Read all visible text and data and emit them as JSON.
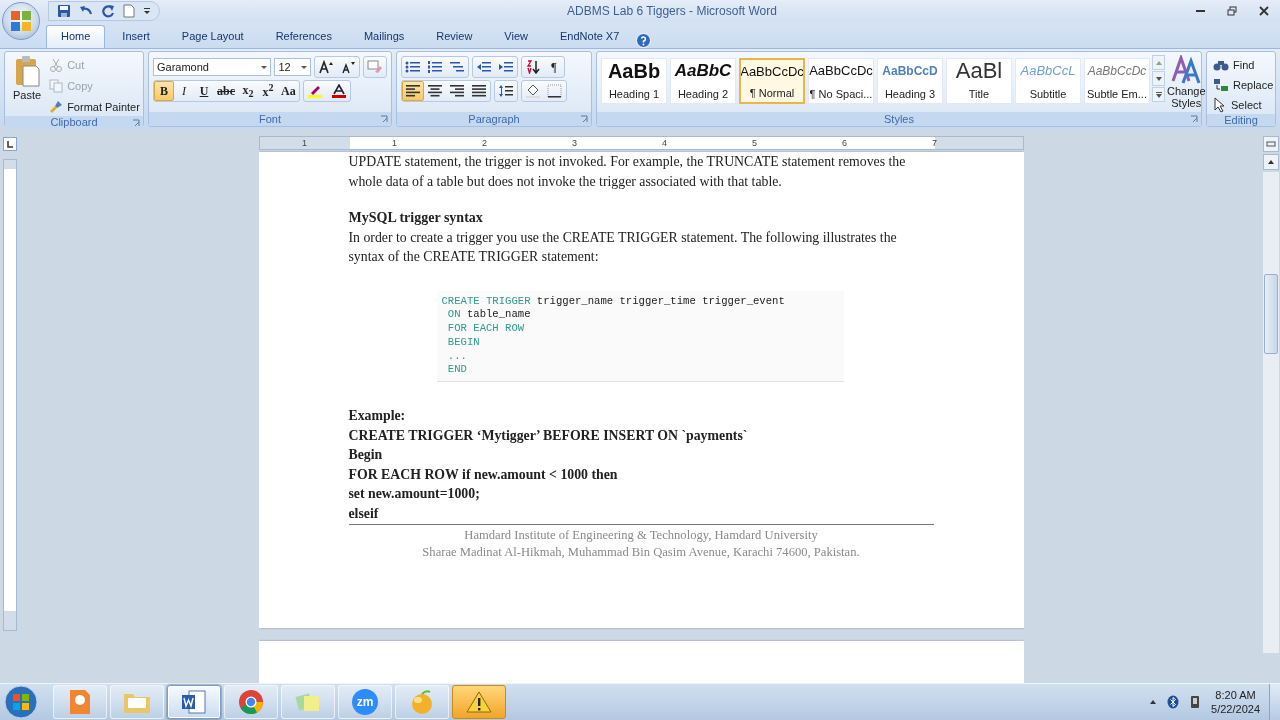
{
  "window": {
    "title": "ADBMS Lab 6 Tiggers - Microsoft Word"
  },
  "quick_access": [
    {
      "kind": "save"
    },
    {
      "kind": "undo"
    },
    {
      "kind": "redo"
    },
    {
      "kind": "new"
    },
    {
      "kind": "more"
    }
  ],
  "tabs": [
    {
      "label": "Home",
      "selected": true
    },
    {
      "label": "Insert",
      "selected": false
    },
    {
      "label": "Page Layout",
      "selected": false
    },
    {
      "label": "References",
      "selected": false
    },
    {
      "label": "Mailings",
      "selected": false
    },
    {
      "label": "Review",
      "selected": false
    },
    {
      "label": "View",
      "selected": false
    },
    {
      "label": "EndNote X7",
      "selected": false
    }
  ],
  "clipboard": {
    "title": "Clipboard",
    "paste": "Paste",
    "items": [
      {
        "label": "Cut",
        "kind": "cut",
        "disabled": true
      },
      {
        "label": "Copy",
        "kind": "copy",
        "disabled": true
      },
      {
        "label": "Format Painter",
        "kind": "brush",
        "disabled": false
      }
    ]
  },
  "font": {
    "title": "Font",
    "name": "Garamond",
    "size": "12",
    "tools": [
      {
        "kind": "grow"
      },
      {
        "kind": "shrink"
      },
      {
        "kind": "clear"
      }
    ],
    "buttons": [
      {
        "kind": "bold",
        "label": "B",
        "selected": true
      },
      {
        "kind": "italic",
        "label": "I",
        "selected": false
      },
      {
        "kind": "underline",
        "label": "U",
        "selected": false
      },
      {
        "kind": "strike",
        "label": "abc",
        "selected": false
      },
      {
        "kind": "subscript",
        "label": "x$_{2}$",
        "selected": false
      },
      {
        "kind": "superscript",
        "label": "x$^{2}$",
        "selected": false
      },
      {
        "kind": "case",
        "label": "Aa",
        "selected": false
      },
      {
        "kind": "highlight",
        "selected": false
      },
      {
        "kind": "fontcolor",
        "selected": false
      }
    ]
  },
  "paragraph": {
    "title": "Paragraph",
    "row1": [
      {
        "kind": "bullets",
        "selected": false
      },
      {
        "kind": "numbering",
        "selected": false
      },
      {
        "kind": "multilevel",
        "selected": false
      },
      {
        "kind": "outdent",
        "selected": false
      },
      {
        "kind": "indent",
        "selected": false
      },
      {
        "kind": "sort",
        "selected": false
      },
      {
        "kind": "text",
        "label": "¶",
        "selected": false
      }
    ],
    "row2": [
      {
        "kind": "align-left",
        "selected": true
      },
      {
        "kind": "align-center",
        "selected": false
      },
      {
        "kind": "align-right",
        "selected": false
      },
      {
        "kind": "justify",
        "selected": false
      },
      {
        "kind": "spacing",
        "selected": false
      },
      {
        "kind": "shading",
        "selected": false
      },
      {
        "kind": "borders",
        "selected": false
      }
    ]
  },
  "styles": {
    "title": "Styles",
    "items": [
      {
        "preview": "AaBb",
        "label": "Heading 1",
        "kind": "h1",
        "selected": false
      },
      {
        "preview": "AaBbC",
        "label": "Heading 2",
        "kind": "h2",
        "selected": false
      },
      {
        "preview": "AaBbCcDc",
        "label": "¶ Normal",
        "kind": "normal",
        "selected": true
      },
      {
        "preview": "AaBbCcDc",
        "label": "¶ No Spaci...",
        "kind": "normal",
        "selected": false
      },
      {
        "preview": "AaBbCcD",
        "label": "Heading 3",
        "kind": "h3",
        "selected": false
      },
      {
        "preview": "AaBl",
        "label": "Title",
        "kind": "title",
        "selected": false
      },
      {
        "preview": "AaBbCcL",
        "label": "Subtitle",
        "kind": "subtitle",
        "selected": false
      },
      {
        "preview": "AaBbCcDc",
        "label": "Subtle Em...",
        "kind": "subtle",
        "selected": false
      }
    ],
    "change": [
      "Change",
      "Styles"
    ]
  },
  "editing": {
    "title": "Editing",
    "items": [
      {
        "label": "Find",
        "kind": "find"
      },
      {
        "label": "Replace",
        "kind": "replace"
      },
      {
        "label": "Select",
        "kind": "select"
      }
    ]
  },
  "ruler": [
    "1",
    "1",
    "2",
    "3",
    "4",
    "5",
    "6",
    "7"
  ],
  "document": [
    {
      "kind": "para",
      "text": "UPDATE statement, the trigger is not invoked. For example, the TRUNCATE statement removes the whole data of a table but does not invoke the trigger associated with that table."
    },
    {
      "kind": "heading",
      "text": "MySQL trigger syntax"
    },
    {
      "kind": "para",
      "text": "In order to create a trigger you use the CREATE TRIGGER statement. The following illustrates the syntax of the CREATE TRIGGER statement:"
    },
    {
      "kind": "code",
      "lines": [
        [
          {
            "text": "CREATE TRIGGER ",
            "kind": "kw"
          },
          {
            "text": "trigger_name trigger_time trigger_event",
            "kind": "id"
          }
        ],
        [
          {
            "text": " ON ",
            "kind": "kw"
          },
          {
            "text": "table_name",
            "kind": "id"
          }
        ],
        [
          {
            "text": " FOR EACH ROW",
            "kind": "kw"
          }
        ],
        [
          {
            "text": " BEGIN",
            "kind": "kw"
          }
        ],
        [
          {
            "text": " ...",
            "kind": "kw"
          }
        ],
        [
          {
            "text": " END",
            "kind": "kw"
          }
        ]
      ]
    },
    {
      "kind": "example",
      "lines": [
        "Example:",
        "CREATE TRIGGER ‘Mytigger’ BEFORE INSERT ON `payments`",
        "Begin",
        "FOR EACH ROW if new.amount < 1000 then",
        "set new.amount=1000;",
        "elseif"
      ]
    }
  ],
  "footer": [
    "Hamdard Institute of Engineering & Technology, Hamdard University",
    "Sharae Madinat Al-Hikmah, Muhammad Bin Qasim Avenue, Karachi 74600, Pakistan."
  ],
  "taskbar": {
    "items": [
      {
        "kind": "pdf",
        "selected": false
      },
      {
        "kind": "folder",
        "selected": false
      },
      {
        "kind": "word",
        "selected": true
      },
      {
        "kind": "chrome",
        "selected": false
      },
      {
        "kind": "notes",
        "selected": false
      },
      {
        "kind": "zoom",
        "label": "zm",
        "selected": false
      },
      {
        "kind": "fruit",
        "selected": false
      },
      {
        "kind": "warning",
        "selected": false,
        "flashing": true
      }
    ],
    "time": "8:20 AM",
    "date": "5/22/2024"
  }
}
